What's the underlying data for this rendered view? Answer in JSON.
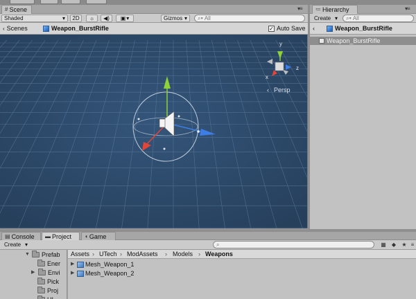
{
  "scene_tab": {
    "label": "Scene"
  },
  "scene_toolbar": {
    "shading": "Shaded",
    "mode_2d": "2D",
    "gizmos": "Gizmos",
    "search_placeholder": "All"
  },
  "scene_breadcrumb": {
    "scenes": "Scenes",
    "object": "Weapon_BurstRifle",
    "auto_save": "Auto Save"
  },
  "gizmo": {
    "x": "x",
    "y": "y",
    "z": "z",
    "projection": "Persp"
  },
  "hierarchy": {
    "tab_label": "Hierarchy",
    "create": "Create",
    "search_placeholder": "All",
    "breadcrumb": "Weapon_BurstRifle",
    "items": [
      {
        "label": "Weapon_BurstRifle",
        "selected": true
      }
    ]
  },
  "bottom_tabs": [
    {
      "label": "Console",
      "active": false
    },
    {
      "label": "Project",
      "active": true
    },
    {
      "label": "Game",
      "active": false
    }
  ],
  "project": {
    "create": "Create",
    "tree": [
      {
        "label": "Prefab",
        "expanded": true
      },
      {
        "label": "Ener"
      },
      {
        "label": "Envi"
      },
      {
        "label": "Pick"
      },
      {
        "label": "Proj"
      },
      {
        "label": "UI"
      }
    ],
    "breadcrumb": [
      "Assets",
      "UTech",
      "ModAssets",
      "Models",
      "Weapons"
    ],
    "assets": [
      {
        "label": "Mesh_Weapon_1"
      },
      {
        "label": "Mesh_Weapon_2"
      }
    ]
  },
  "colors": {
    "scene_bg": "#2f4d6c",
    "grid": "#6b88a8",
    "gizmo_x": "#e0463a",
    "gizmo_y": "#8fd13b",
    "gizmo_z": "#3c7ee6",
    "selection": "#8e8e8e"
  }
}
